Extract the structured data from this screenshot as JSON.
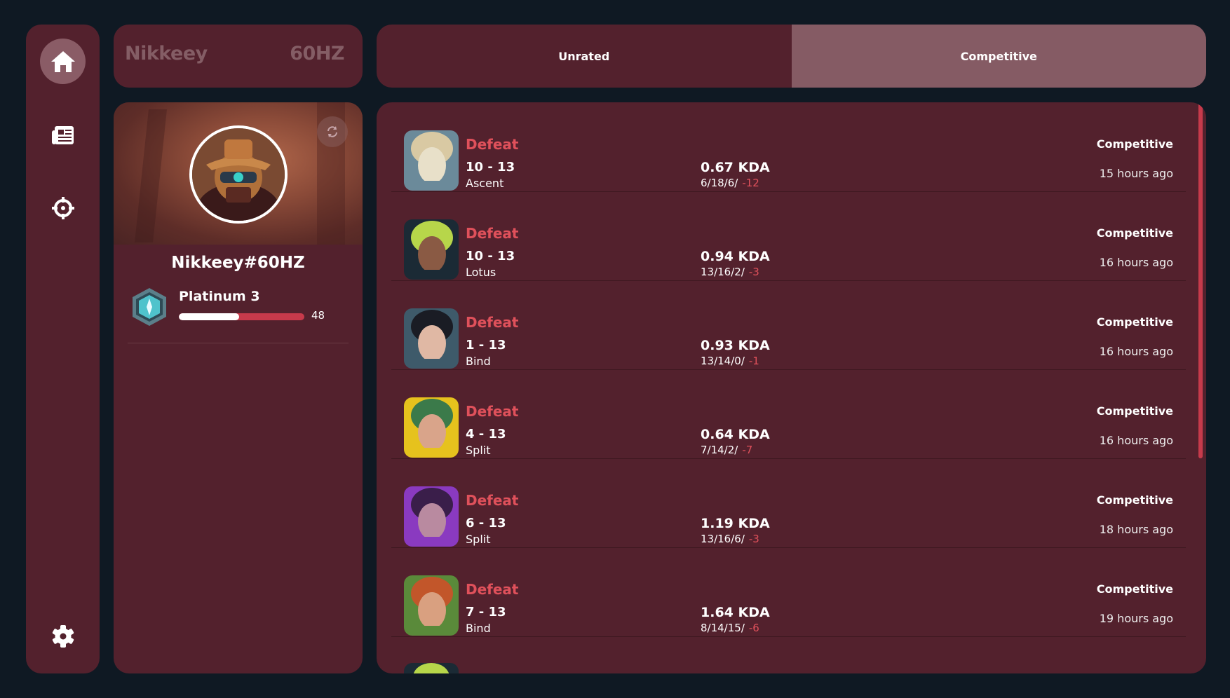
{
  "sidebar": {
    "items": [
      {
        "icon": "home-icon",
        "active": true
      },
      {
        "icon": "newspaper-icon",
        "active": false
      },
      {
        "icon": "crosshair-icon",
        "active": false
      }
    ],
    "bottom": {
      "icon": "gear-icon"
    }
  },
  "header": {
    "name": "Nikkeey",
    "tag": "60HZ"
  },
  "tabs": [
    {
      "label": "Unrated",
      "selected": false
    },
    {
      "label": "Competitive",
      "selected": true
    }
  ],
  "profile": {
    "riot_id": "Nikkeey#60HZ",
    "rank": "Platinum 3",
    "rr": "48",
    "rr_fraction": 0.48,
    "refresh_icon": "refresh-icon"
  },
  "matches": [
    {
      "result": "Defeat",
      "score": "10 - 13",
      "map": "Ascent",
      "kda": "0.67 KDA",
      "kda_line": "6/18/6/",
      "rr": "-12",
      "mode": "Competitive",
      "time": "15 hours ago",
      "agent_colors": [
        "#d9c9a3",
        "#e8e0c9",
        "#6b8a9a"
      ]
    },
    {
      "result": "Defeat",
      "score": "10 - 13",
      "map": "Lotus",
      "kda": "0.94 KDA",
      "kda_line": "13/16/2/",
      "rr": "-3",
      "mode": "Competitive",
      "time": "16 hours ago",
      "agent_colors": [
        "#b7d64a",
        "#8a5a44",
        "#1b2a35"
      ]
    },
    {
      "result": "Defeat",
      "score": "1 - 13",
      "map": "Bind",
      "kda": "0.93 KDA",
      "kda_line": "13/14/0/",
      "rr": "-1",
      "mode": "Competitive",
      "time": "16 hours ago",
      "agent_colors": [
        "#1a1c24",
        "#e0b8a4",
        "#3e5a6a"
      ]
    },
    {
      "result": "Defeat",
      "score": "4 - 13",
      "map": "Split",
      "kda": "0.64 KDA",
      "kda_line": "7/14/2/",
      "rr": "-7",
      "mode": "Competitive",
      "time": "16 hours ago",
      "agent_colors": [
        "#3b7a4a",
        "#d9a48a",
        "#e6c21d"
      ]
    },
    {
      "result": "Defeat",
      "score": "6 - 13",
      "map": "Split",
      "kda": "1.19 KDA",
      "kda_line": "13/16/6/",
      "rr": "-3",
      "mode": "Competitive",
      "time": "18 hours ago",
      "agent_colors": [
        "#3a1e4a",
        "#b98aa0",
        "#8a3ac0"
      ]
    },
    {
      "result": "Defeat",
      "score": "7 - 13",
      "map": "Bind",
      "kda": "1.64 KDA",
      "kda_line": "8/14/15/",
      "rr": "-6",
      "mode": "Competitive",
      "time": "19 hours ago",
      "agent_colors": [
        "#c2562a",
        "#d9a080",
        "#5a8a3a"
      ]
    }
  ],
  "colors": {
    "background": "#0f1923",
    "panel": "#53212d",
    "accent_red": "#e0515b",
    "tab_selected": "#855b64"
  }
}
